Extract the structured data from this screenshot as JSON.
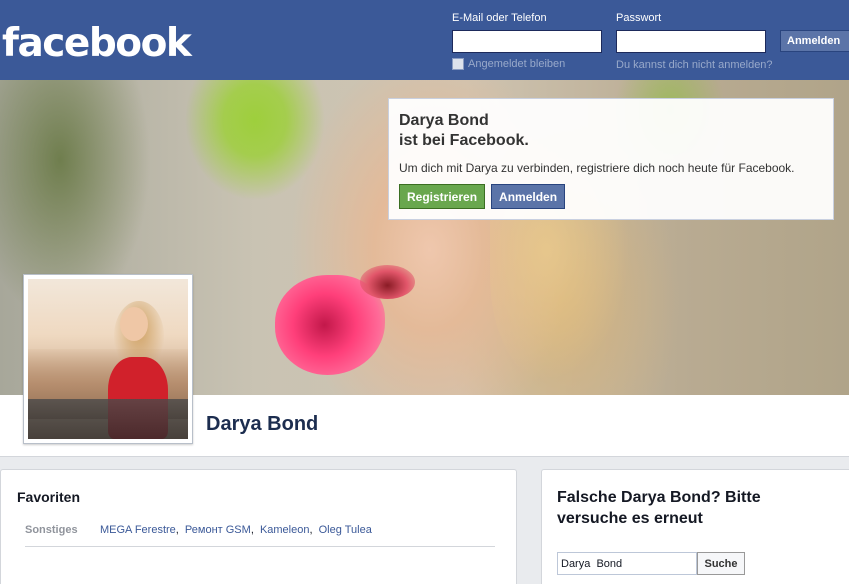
{
  "header": {
    "logo": "facebook",
    "email_label": "E-Mail oder Telefon",
    "email_value": "",
    "password_label": "Passwort",
    "password_value": "",
    "login_button": "Anmelden",
    "remember_label": "Angemeldet bleiben",
    "forgot_link": "Du kannst dich nicht anmelden?"
  },
  "popup": {
    "name": "Darya Bond",
    "subtitle": "ist bei Facebook.",
    "text": "Um dich mit Darya zu verbinden, registriere dich noch heute für Facebook.",
    "register_button": "Registrieren",
    "login_button": "Anmelden"
  },
  "profile": {
    "name": "Darya Bond"
  },
  "favorites": {
    "title": "Favoriten",
    "category": "Sonstiges",
    "items": [
      "MEGA Ferestre",
      "Ремонт GSM",
      "Kameleon",
      "Oleg Tulea"
    ]
  },
  "search": {
    "title": "Falsche Darya Bond? Bitte versuche es erneut",
    "input_value": "Darya  Bond",
    "button": "Suche"
  },
  "colors": {
    "brand_blue": "#3b5998",
    "register_green": "#69a74e"
  }
}
